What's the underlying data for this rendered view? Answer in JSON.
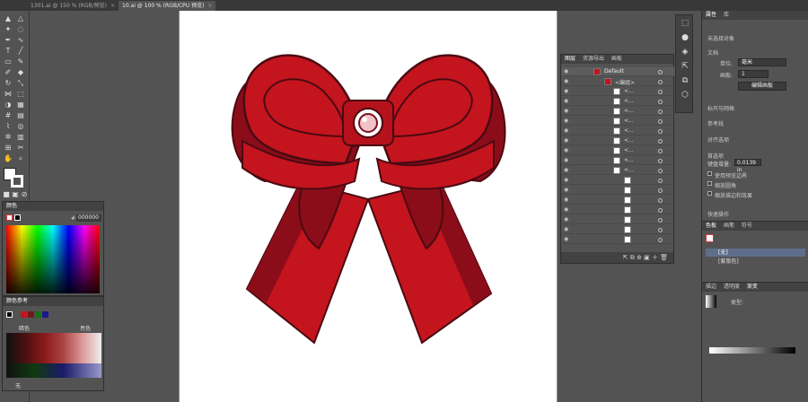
{
  "tabs": [
    {
      "label": "1301.ai @ 150 % (RGB/预览)",
      "active": false
    },
    {
      "label": "10.ai @ 100 % (RGB/CPU 预览)",
      "active": true
    }
  ],
  "colors": {
    "bow_red": "#c4141e",
    "bow_dark": "#8b0d1a",
    "bow_outline": "#4a0a12",
    "panel_bg": "#535353"
  },
  "color_panel": {
    "title": "颜色",
    "hex": "000000"
  },
  "color_guide": {
    "title": "颜色参考",
    "left": "暗色",
    "right": "亮色",
    "footer": "无"
  },
  "layers": {
    "tabs": [
      "图层",
      "资源导出",
      "画板"
    ],
    "top": "Default",
    "group": "<编组>",
    "items": [
      "<...",
      "<...",
      "<...",
      "<...",
      "<...",
      "<...",
      "<...",
      "<...",
      "<..."
    ]
  },
  "properties": {
    "tabs": [
      "属性",
      "库"
    ],
    "no_selection": "未选择对象",
    "doc_label": "文档",
    "unit_label": "单位:",
    "unit_value": "毫米",
    "artboard_label": "画板:",
    "artboard_value": "1",
    "edit_artboard": "编辑画板",
    "rulers_grids": "标尺与网格",
    "guides": "参考线",
    "align_to": "对齐选项",
    "preferences": "首选项",
    "keyboard_inc": "键盘增量:",
    "keyboard_inc_value": "0.0139 in",
    "use_preview_bounds": "使用预览边界",
    "scale_corners": "缩放圆角",
    "scale_strokes": "缩放描边和效果",
    "quick_actions": "快速操作"
  },
  "swatches_panel": {
    "tabs": [
      "色板",
      "画笔",
      "符号"
    ],
    "items": [
      "[无]",
      "[套版色]"
    ]
  },
  "gradient_panel": {
    "tabs": [
      "描边",
      "透明度",
      "渐变"
    ],
    "type_label": "类型:"
  }
}
